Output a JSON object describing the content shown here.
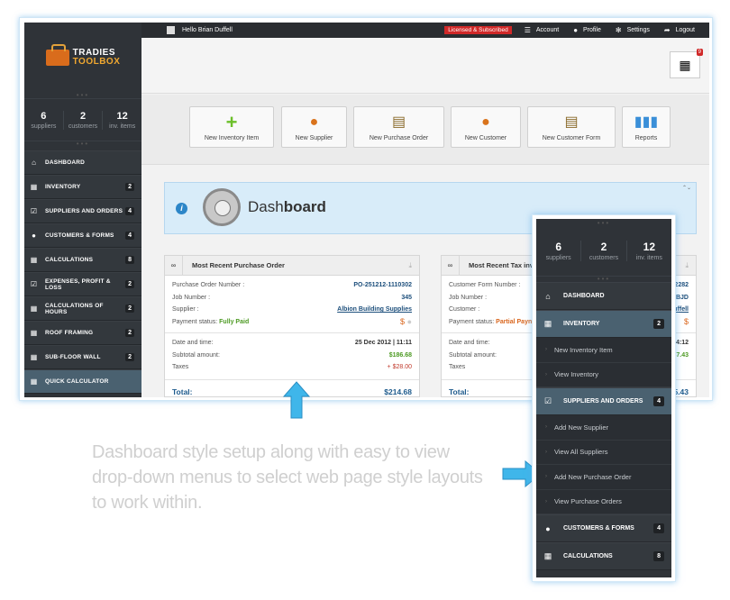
{
  "brand": {
    "line1": "TRADIES",
    "line2": "TOOLBOX"
  },
  "stats": [
    {
      "value": "6",
      "label": "suppliers"
    },
    {
      "value": "2",
      "label": "customers"
    },
    {
      "value": "12",
      "label": "inv. items"
    }
  ],
  "sidebar_menu": [
    {
      "label": "DASHBOARD",
      "badge": ""
    },
    {
      "label": "INVENTORY",
      "badge": "2"
    },
    {
      "label": "SUPPLIERS AND ORDERS",
      "badge": "4"
    },
    {
      "label": "CUSTOMERS & FORMS",
      "badge": "4"
    },
    {
      "label": "CALCULATIONS",
      "badge": "8"
    },
    {
      "label": "EXPENSES, PROFIT & LOSS",
      "badge": "2"
    },
    {
      "label": "CALCULATIONS OF HOURS",
      "badge": "2"
    },
    {
      "label": "ROOF FRAMING",
      "badge": "2"
    },
    {
      "label": "SUB-FLOOR WALL",
      "badge": "2"
    },
    {
      "label": "QUICK CALCULATOR",
      "badge": ""
    }
  ],
  "topbar": {
    "user": "Hello Brian Duffell",
    "license": "Licensed & Subscribed",
    "account": "Account",
    "profile": "Profile",
    "settings": "Settings",
    "logout": "Logout"
  },
  "calculator_badge": "9",
  "quick_actions": [
    "New Inventory Item",
    "New Supplier",
    "New Purchase Order",
    "New Customer",
    "New Customer Form",
    "Reports"
  ],
  "dashboard": {
    "title_light": "Dash",
    "title_bold": "board"
  },
  "po_panel": {
    "title": "Most Recent Purchase Order",
    "po_number_label": "Purchase Order Number :",
    "po_number": "PO-251212-1110302",
    "job_label": "Job Number :",
    "job": "345",
    "supplier_label": "Supplier :",
    "supplier": "Albion Building Supplies",
    "status_label": "Payment status:",
    "status": "Fully Paid",
    "currency": "$",
    "date_label": "Date and time:",
    "date": "25 Dec 2012 | 11:11",
    "subtotal_label": "Subtotal amount:",
    "subtotal": "$186.68",
    "taxes_label": "Taxes",
    "taxes": "+ $28.00",
    "total_label": "Total:",
    "total": "$214.68"
  },
  "tax_panel": {
    "title": "Most Recent Tax invo",
    "form_label": "Customer Form Number :",
    "form_value": "2282",
    "job_label": "Job Number :",
    "job_value": "BJD",
    "customer_label": "Customer :",
    "customer_value": "uffell",
    "status_label": "Payment status:",
    "status": "Partial Payn",
    "currency": "$",
    "date_label": "Date and time:",
    "date_value": "4:12",
    "subtotal_label": "Subtotal amount:",
    "subtotal_value": "37.43",
    "taxes_label": "Taxes",
    "total_label": "Total:",
    "total_value": "5.43"
  },
  "dropdown": {
    "stats": [
      {
        "value": "6",
        "label": "suppliers"
      },
      {
        "value": "2",
        "label": "customers"
      },
      {
        "value": "12",
        "label": "inv. items"
      }
    ],
    "dashboard": "DASHBOARD",
    "inventory": "INVENTORY",
    "inventory_badge": "2",
    "inventory_items": [
      "New Inventory Item",
      "View Inventory"
    ],
    "suppliers": "SUPPLIERS AND ORDERS",
    "suppliers_badge": "4",
    "suppliers_items": [
      "Add New Supplier",
      "View All Suppliers",
      "Add New Purchase Order",
      "View Purchase Orders"
    ],
    "customers": "CUSTOMERS & FORMS",
    "customers_badge": "4",
    "calculations": "CALCULATIONS",
    "calculations_badge": "8"
  },
  "caption": "Dashboard style setup along with easy to view drop-down menus to select web page style layouts to work within.",
  "colors": {
    "accent": "#3aaee0",
    "sidebar": "#2f3338",
    "active": "#4a6170",
    "badge_red": "#d02828"
  }
}
